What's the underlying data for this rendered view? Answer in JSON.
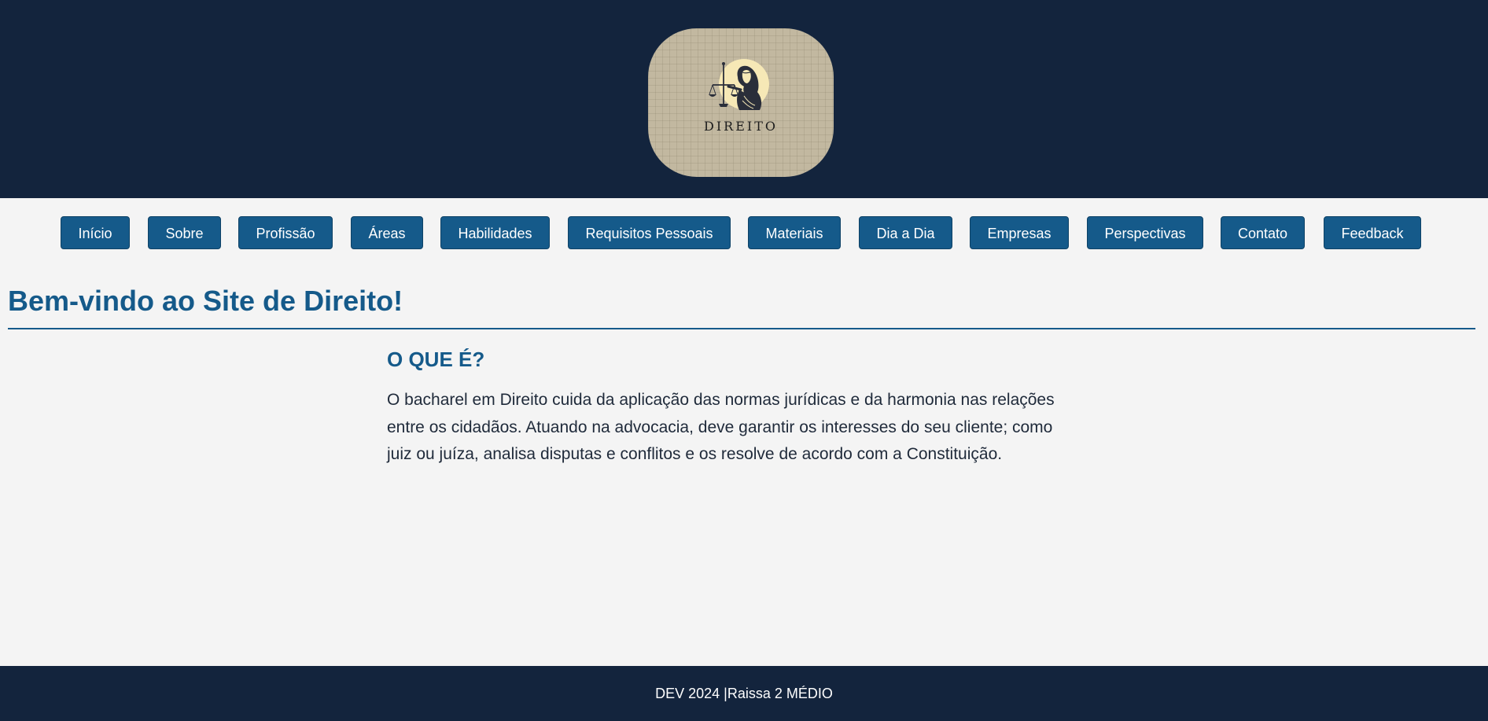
{
  "header": {
    "logo_text": "DIREITO",
    "logo_icon": "lady-justice-scales-icon"
  },
  "nav": {
    "items": [
      {
        "label": "Início"
      },
      {
        "label": "Sobre"
      },
      {
        "label": "Profissão"
      },
      {
        "label": "Áreas"
      },
      {
        "label": "Habilidades"
      },
      {
        "label": "Requisitos Pessoais"
      },
      {
        "label": "Materiais"
      },
      {
        "label": "Dia a Dia"
      },
      {
        "label": "Empresas"
      },
      {
        "label": "Perspectivas"
      },
      {
        "label": "Contato"
      },
      {
        "label": "Feedback"
      }
    ]
  },
  "main": {
    "title": "Bem-vindo ao Site de Direito!",
    "section": {
      "heading": "O QUE É?",
      "text": "O bacharel em Direito cuida da aplicação das normas jurídicas e da harmonia nas relações entre os cidadãos. Atuando na advocacia, deve garantir os interesses do seu cliente; como juiz ou juíza, analisa disputas e conflitos e os resolve de acordo com a Constituição."
    }
  },
  "footer": {
    "text": "DEV 2024 |Raissa 2 MÉDIO"
  },
  "colors": {
    "header_bg": "#13243d",
    "accent": "#155a8a",
    "page_bg": "#f4f4f4",
    "logo_bg": "#c2b8a0"
  }
}
